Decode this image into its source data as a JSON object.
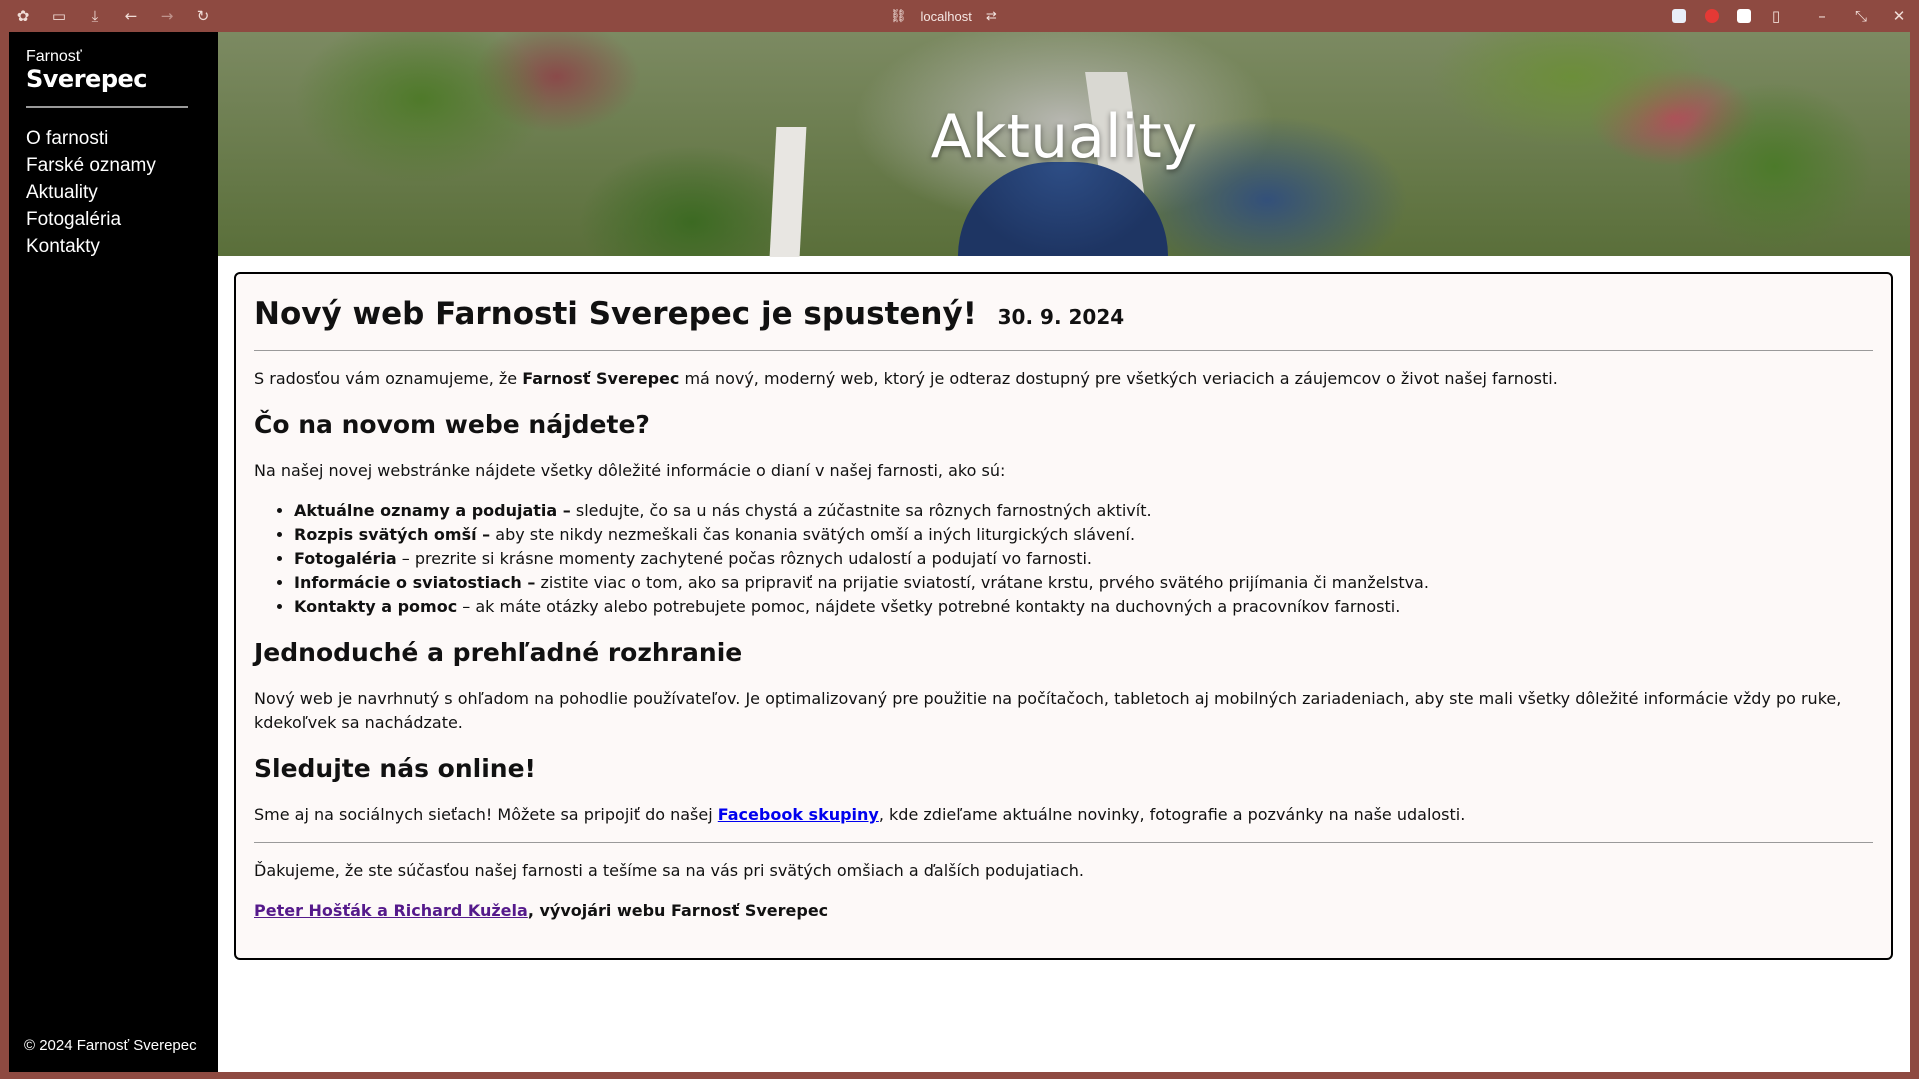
{
  "browser": {
    "url": "localhost",
    "icons": [
      "extensions-icon",
      "sidebar-icon",
      "download-icon",
      "back-icon",
      "forward-icon",
      "reload-icon"
    ]
  },
  "sidebar": {
    "brand_small": "Farnosť",
    "brand_big": "Sverepec",
    "items": [
      {
        "label": "O farnosti"
      },
      {
        "label": "Farské oznamy"
      },
      {
        "label": "Aktuality"
      },
      {
        "label": "Fotogaléria"
      },
      {
        "label": "Kontakty"
      }
    ],
    "footer": "© 2024 Farnosť Sverepec"
  },
  "hero": {
    "title": "Aktuality"
  },
  "article": {
    "title": "Nový web Farnosti Sverepec je spustený!",
    "date": "30. 9. 2024",
    "intro_before": "S radosťou vám oznamujeme, že ",
    "intro_bold": "Farnosť Sverepec",
    "intro_after": " má nový, moderný web, ktorý je odteraz dostupný pre všetkých veriacich a záujemcov o život našej farnosti.",
    "h2_find": "Čo na novom webe nájdete?",
    "find_text": "Na našej novej webstránke nájdete všetky dôležité informácie o dianí v našej farnosti, ako sú:",
    "list": [
      {
        "bold": "Aktuálne oznamy a podujatia –",
        "text": " sledujte, čo sa u nás chystá a zúčastnite sa rôznych farnostných aktivít."
      },
      {
        "bold": "Rozpis svätých omší –",
        "text": " aby ste nikdy nezmeškali čas konania svätých omší a iných liturgických slávení."
      },
      {
        "bold": "Fotogaléria",
        "text": " – prezrite si krásne momenty zachytené počas rôznych udalostí a podujatí vo farnosti."
      },
      {
        "bold": "Informácie o sviatostiach –",
        "text": " zistite viac o tom, ako sa pripraviť na prijatie sviatostí, vrátane krstu, prvého svätého prijímania či manželstva."
      },
      {
        "bold": "Kontakty a pomoc",
        "text": " – ak máte otázky alebo potrebujete pomoc, nájdete všetky potrebné kontakty na duchovných a pracovníkov farnosti."
      }
    ],
    "h2_ui": "Jednoduché a prehľadné rozhranie",
    "ui_text": "Nový web je navrhnutý s ohľadom na pohodlie používateľov. Je optimalizovaný pre použitie na počítačoch, tabletoch aj mobilných zariadeniach, aby ste mali všetky dôležité informácie vždy po ruke, kdekoľvek sa nachádzate.",
    "h2_online": "Sledujte nás online!",
    "online_before": "Sme aj na sociálnych sieťach! Môžete sa pripojiť do našej ",
    "online_link": "Facebook skupiny",
    "online_after": ", kde zdieľame aktuálne novinky, fotografie a pozvánky na naše udalosti.",
    "thanks": "Ďakujeme, že ste súčasťou našej farnosti a tešíme sa na vás pri svätých omšiach a ďalších podujatiach.",
    "authors_link": "Peter Hošťák a Richard Kužela",
    "authors_after": ", vývojári webu Farnosť Sverepec"
  }
}
